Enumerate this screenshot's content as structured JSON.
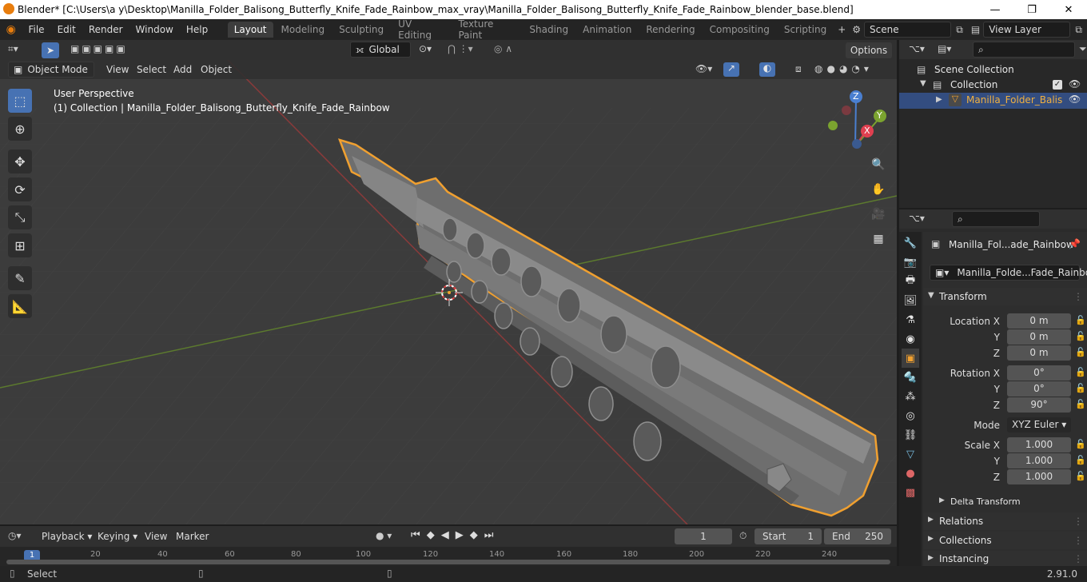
{
  "window": {
    "title": "Blender* [C:\\Users\\a y\\Desktop\\Manilla_Folder_Balisong_Butterfly_Knife_Fade_Rainbow_max_vray\\Manilla_Folder_Balisong_Butterfly_Knife_Fade_Rainbow_blender_base.blend]"
  },
  "menu": [
    "File",
    "Edit",
    "Render",
    "Window",
    "Help"
  ],
  "workspaces": [
    "Layout",
    "Modeling",
    "Sculpting",
    "UV Editing",
    "Texture Paint",
    "Shading",
    "Animation",
    "Rendering",
    "Compositing",
    "Scripting"
  ],
  "scene": {
    "name": "Scene"
  },
  "view_layer": {
    "name": "View Layer"
  },
  "toolbar": {
    "transform_orientation": "Global",
    "options": "Options"
  },
  "viewport_header": {
    "mode": "Object Mode",
    "view": "View",
    "select": "Select",
    "add": "Add",
    "object": "Object"
  },
  "viewport": {
    "perspective": "User Perspective",
    "collection_info": "(1) Collection | Manilla_Folder_Balisong_Butterfly_Knife_Fade_Rainbow"
  },
  "gizmo": {
    "z": "Z",
    "y": "Y",
    "x": "X"
  },
  "outliner": {
    "scene_collection": "Scene Collection",
    "collection": "Collection",
    "object": "Manilla_Folder_Balis"
  },
  "properties": {
    "object_name": "Manilla_Fol...ade_Rainbow",
    "data_name": "Manilla_Folde...Fade_Rainbow",
    "transform": "Transform",
    "location": {
      "label": "Location X",
      "x": "0 m",
      "y": "0 m",
      "z": "0 m"
    },
    "rotation": {
      "label": "Rotation X",
      "x": "0°",
      "y": "0°",
      "z": "90°"
    },
    "mode": {
      "label": "Mode",
      "value": "XYZ Euler"
    },
    "scale": {
      "label": "Scale X",
      "x": "1.000",
      "y": "1.000",
      "z": "1.000"
    },
    "axis_y": "Y",
    "axis_z": "Z",
    "delta_transform": "Delta Transform",
    "relations": "Relations",
    "collections": "Collections",
    "instancing": "Instancing"
  },
  "timeline": {
    "playback": "Playback",
    "keying": "Keying",
    "view": "View",
    "marker": "Marker",
    "current_frame": "1",
    "start_label": "Start",
    "start": "1",
    "end_label": "End",
    "end": "250",
    "ticks": [
      "1",
      "20",
      "40",
      "60",
      "80",
      "100",
      "120",
      "140",
      "160",
      "180",
      "200",
      "220",
      "240"
    ]
  },
  "status": {
    "left": "Select",
    "version": "2.91.0"
  }
}
